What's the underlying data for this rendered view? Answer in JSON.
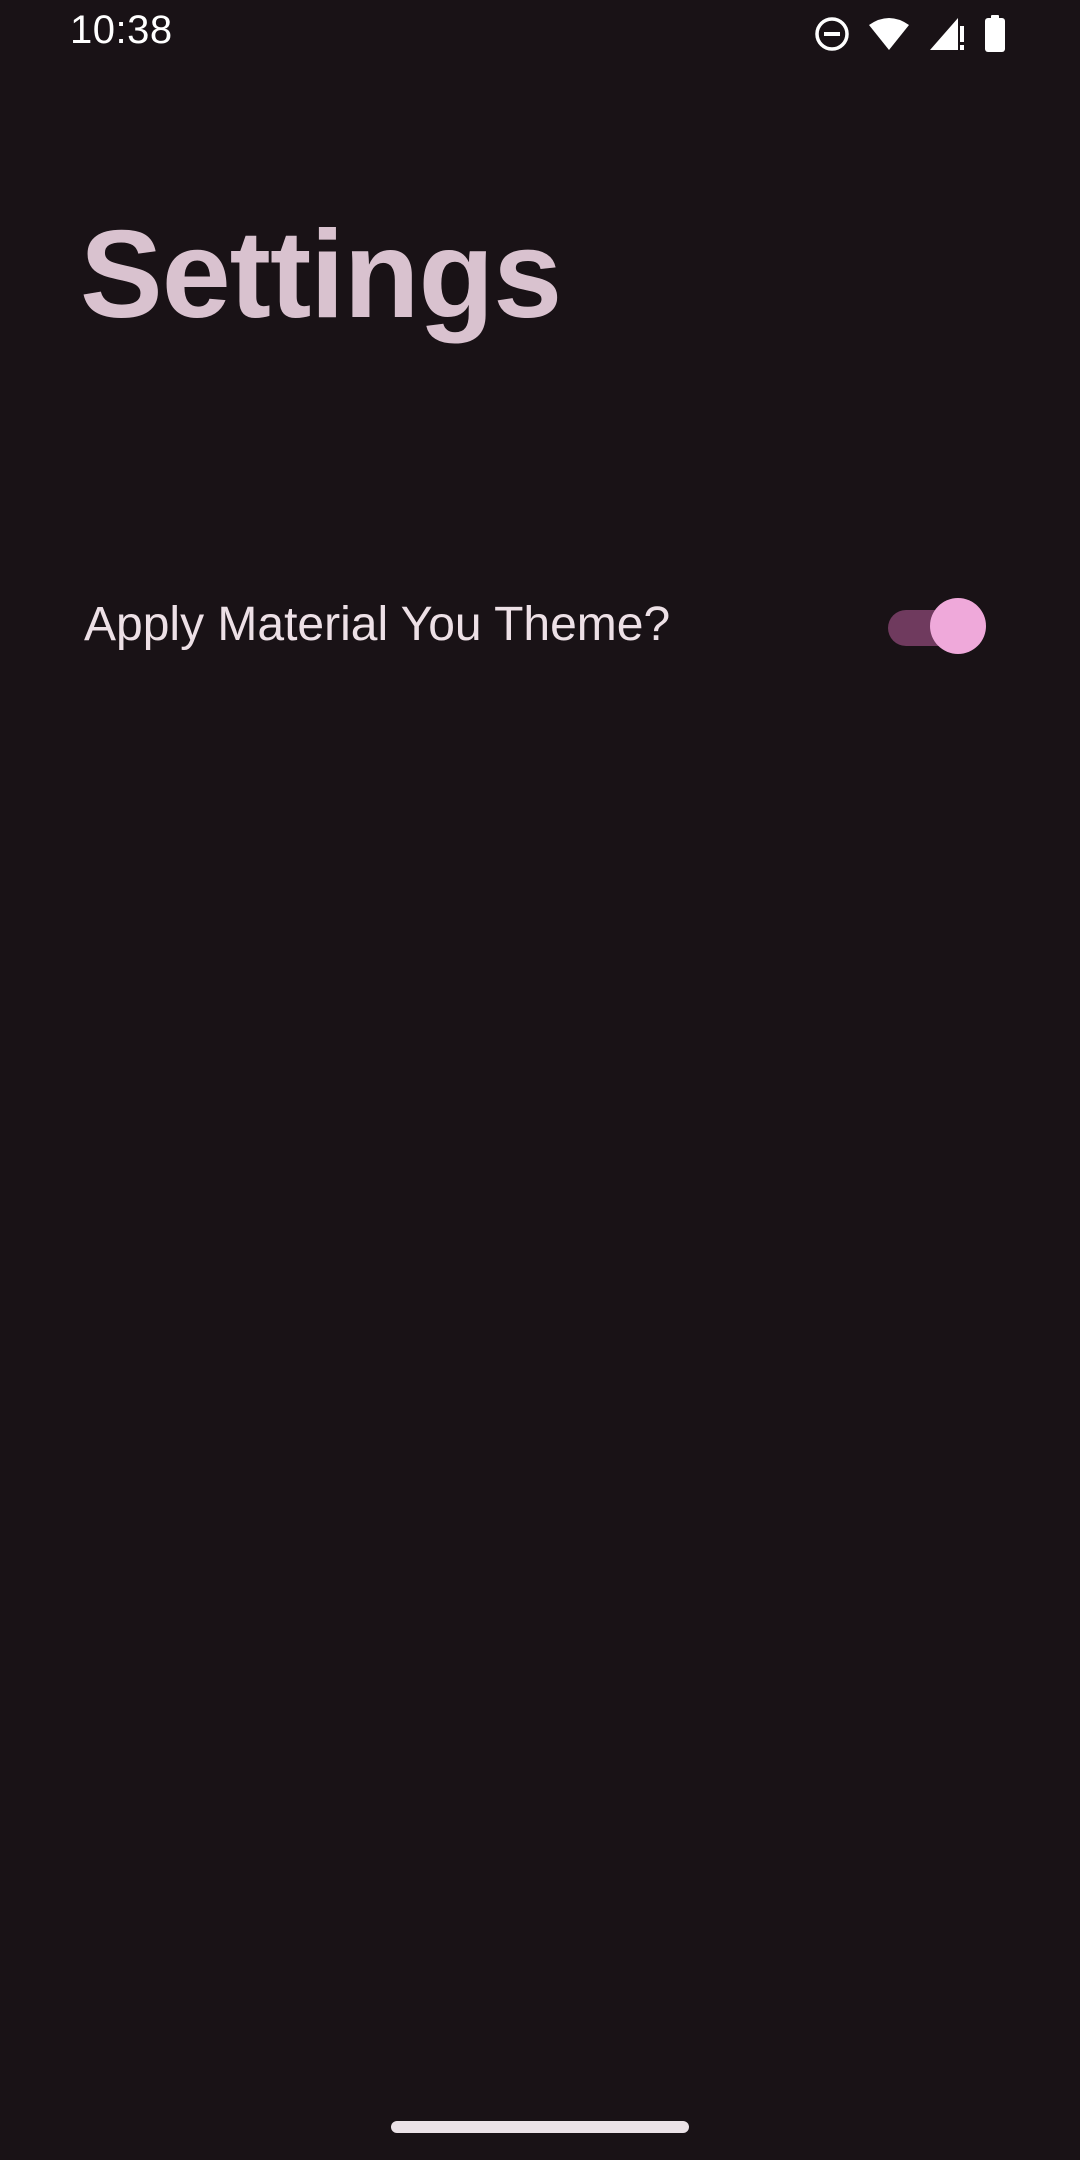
{
  "status_bar": {
    "time": "10:38",
    "icons": [
      "do-not-disturb-icon",
      "wifi-icon",
      "cellular-no-data-icon",
      "battery-icon"
    ]
  },
  "page": {
    "title": "Settings"
  },
  "settings": [
    {
      "label": "Apply Material You Theme?",
      "checked": true
    }
  ],
  "colors": {
    "background": "#191216",
    "title": "#d9c2cf",
    "label": "#ede0e6",
    "switch_track_on": "#6f3a5e",
    "switch_thumb_on": "#efa9da",
    "nav_handle": "#ebe2e7"
  }
}
